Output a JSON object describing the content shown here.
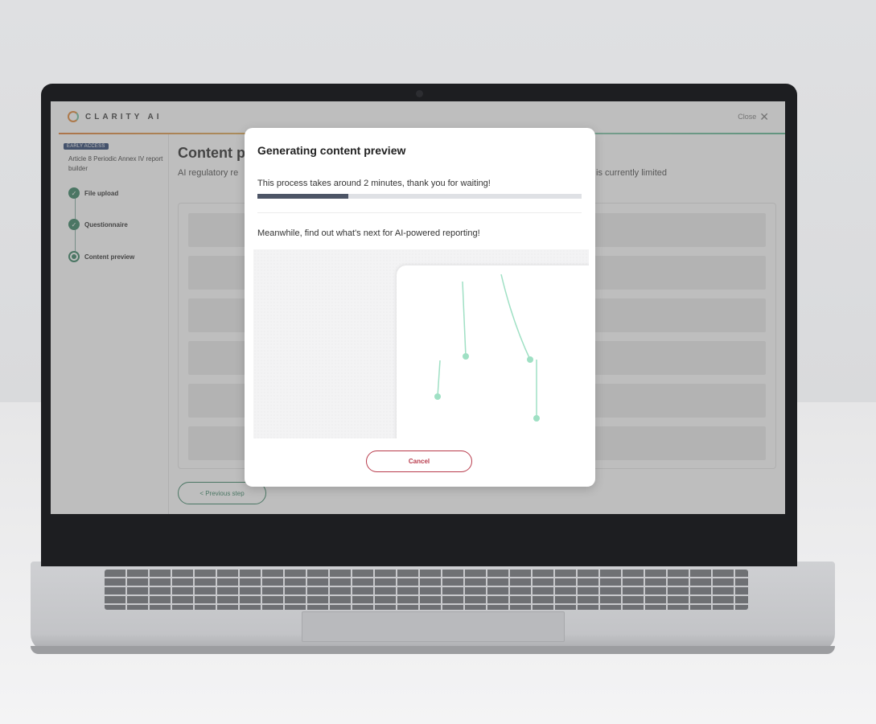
{
  "app": {
    "logo_text": "CLARITY AI",
    "close_label": "Close"
  },
  "sidebar": {
    "badge": "EARLY ACCESS",
    "report_name": "Article 8 Periodic Annex IV report builder",
    "steps": [
      {
        "label": "File upload",
        "status": "done"
      },
      {
        "label": "Questionnaire",
        "status": "done"
      },
      {
        "label": "Content preview",
        "status": "current"
      }
    ]
  },
  "main": {
    "title": "Content p",
    "subtitle": "AI regulatory re",
    "subtitle_right": "is currently limited",
    "prev_button": "< Previous step"
  },
  "modal": {
    "title": "Generating content preview",
    "process_text": "This process takes around 2 minutes, thank you for waiting!",
    "progress": 0.28,
    "meanwhile_text": "Meanwhile, find out what's next for AI-powered reporting!",
    "cancel_label": "Cancel"
  },
  "colors": {
    "accent_green": "#2e7d5b",
    "line_green": "#9fe0c4",
    "cancel_red": "#b83a4b",
    "badge_navy": "#213b6b",
    "progress_fill": "#4d5566"
  }
}
